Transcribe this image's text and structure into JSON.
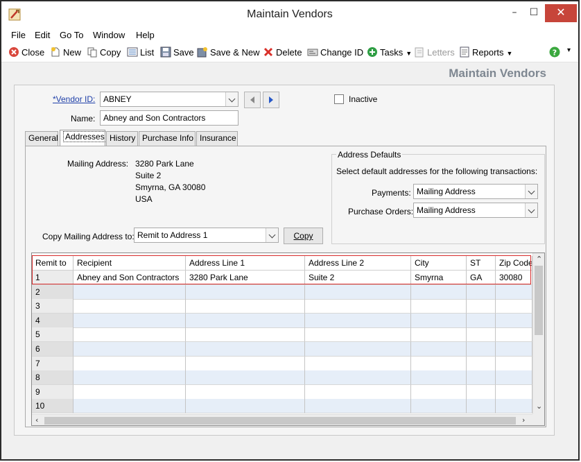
{
  "window": {
    "title": "Maintain Vendors",
    "min_glyph": "–",
    "max_glyph": "☐",
    "close_glyph": "✕"
  },
  "menu": [
    "File",
    "Edit",
    "Go To",
    "Window",
    "Help"
  ],
  "toolbar": {
    "close": "Close",
    "new": "New",
    "copy": "Copy",
    "list": "List",
    "save": "Save",
    "save_new": "Save & New",
    "delete": "Delete",
    "change_id": "Change ID",
    "tasks": "Tasks",
    "letters": "Letters",
    "reports": "Reports"
  },
  "header": "Maintain Vendors",
  "vendor": {
    "id_label": "*Vendor ID:",
    "id_value": "ABNEY",
    "name_label": "Name:",
    "name_value": "Abney and Son Contractors",
    "inactive_label": "Inactive"
  },
  "tabs": [
    "General",
    "Addresses",
    "History",
    "Purchase Info",
    "Insurance"
  ],
  "mailing": {
    "label": "Mailing Address:",
    "lines": [
      "3280 Park Lane",
      "Suite 2",
      "Smyrna, GA  30080",
      "USA"
    ]
  },
  "address_defaults": {
    "title": "Address Defaults",
    "description": "Select default addresses for the following transactions:",
    "payments_label": "Payments:",
    "payments_value": "Mailing Address",
    "po_label": "Purchase Orders:",
    "po_value": "Mailing Address"
  },
  "copy_to": {
    "label": "Copy Mailing Address to:",
    "value": "Remit to Address 1",
    "button": "Copy"
  },
  "grid": {
    "columns": [
      "Remit to",
      "Recipient",
      "Address Line 1",
      "Address Line 2",
      "City",
      "ST",
      "Zip Code"
    ],
    "rows": [
      [
        "1",
        "Abney and Son Contractors",
        "3280 Park Lane",
        "Suite 2",
        "Smyrna",
        "GA",
        "30080"
      ],
      [
        "2",
        "",
        "",
        "",
        "",
        "",
        ""
      ],
      [
        "3",
        "",
        "",
        "",
        "",
        "",
        ""
      ],
      [
        "4",
        "",
        "",
        "",
        "",
        "",
        ""
      ],
      [
        "5",
        "",
        "",
        "",
        "",
        "",
        ""
      ],
      [
        "6",
        "",
        "",
        "",
        "",
        "",
        ""
      ],
      [
        "7",
        "",
        "",
        "",
        "",
        "",
        ""
      ],
      [
        "8",
        "",
        "",
        "",
        "",
        "",
        ""
      ],
      [
        "9",
        "",
        "",
        "",
        "",
        "",
        ""
      ],
      [
        "10",
        "",
        "",
        "",
        "",
        "",
        ""
      ]
    ]
  },
  "colors": {
    "accent_blue": "#1e3fa8",
    "close_red": "#c7453a",
    "highlight_red": "#d62a2a",
    "header_gray": "#7e8791"
  }
}
